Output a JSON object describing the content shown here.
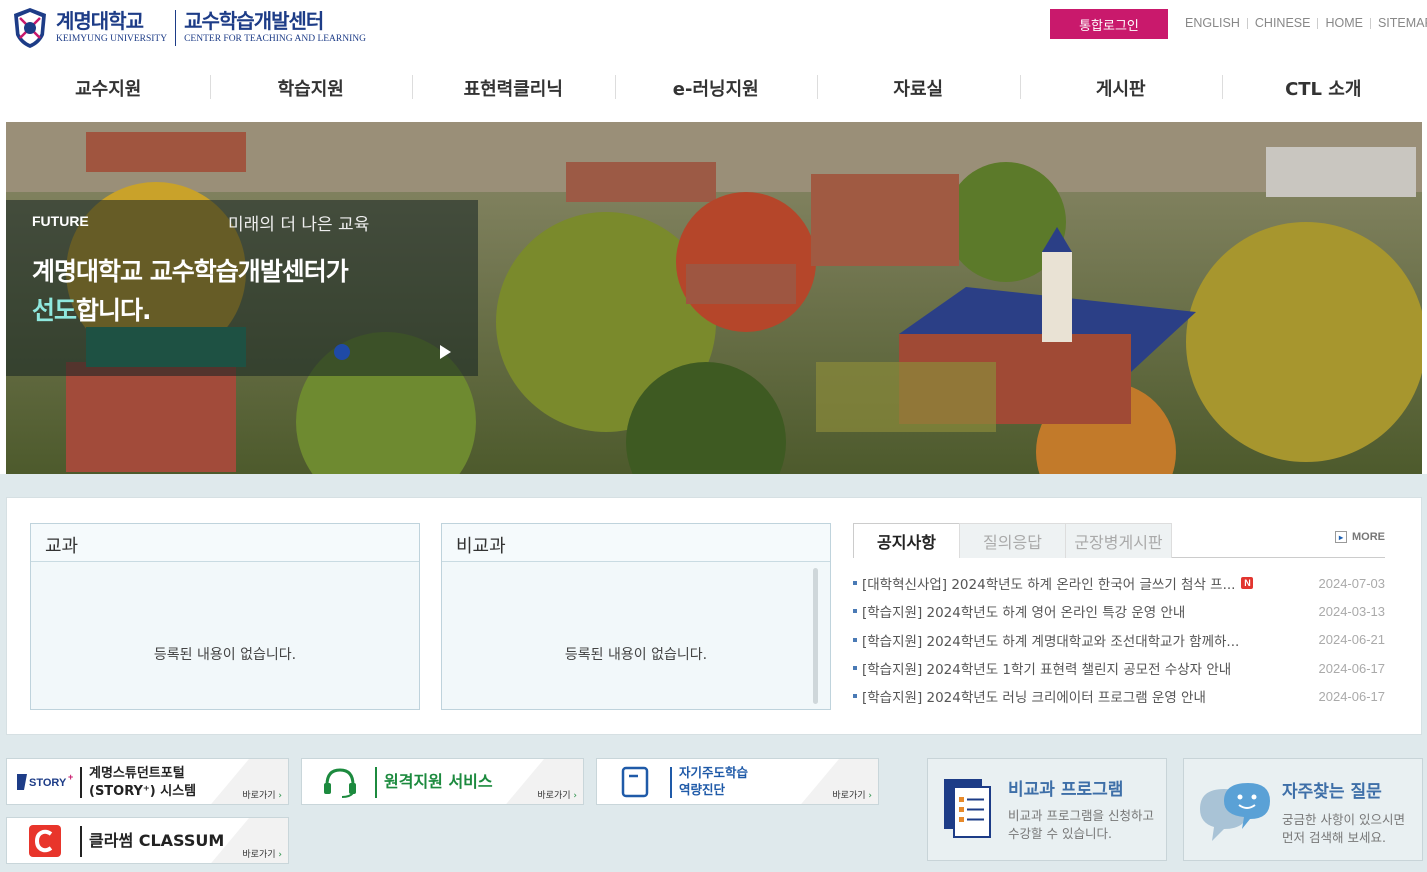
{
  "header": {
    "logo_ko": "계명대학교",
    "logo_en": "KEIMYUNG UNIVERSITY",
    "center_ko": "교수학습개발센터",
    "center_en": "CENTER FOR TEACHING AND LEARNING",
    "login_label": "통합로그인",
    "util_links": [
      "ENGLISH",
      "CHINESE",
      "HOME",
      "SITEMAP"
    ]
  },
  "nav": [
    "교수지원",
    "학습지원",
    "표현력클리닉",
    "e-러닝지원",
    "자료실",
    "게시판",
    "CTL 소개"
  ],
  "hero": {
    "tag": "FUTURE",
    "subtitle": "미래의 더 나은 교육",
    "line1": "계명대학교 교수학습개발센터가",
    "line2_highlight": "선도",
    "line2_rest": "합니다."
  },
  "boxes": {
    "curricular": {
      "title": "교과",
      "empty": "등록된 내용이 없습니다."
    },
    "extracurricular": {
      "title": "비교과",
      "empty": "등록된 내용이 없습니다."
    }
  },
  "notice": {
    "tabs": [
      "공지사항",
      "질의응답",
      "군장병게시판"
    ],
    "more": "MORE",
    "new_badge": "N",
    "items": [
      {
        "title": "[대학혁신사업] 2024학년도 하계 온라인 한국어 글쓰기 첨삭 프...",
        "date": "2024-07-03",
        "new": true
      },
      {
        "title": "[학습지원] 2024학년도 하계 영어 온라인 특강 운영 안내",
        "date": "2024-03-13",
        "new": false
      },
      {
        "title": "[학습지원] 2024학년도 하계 계명대학교와 조선대학교가 함께하...",
        "date": "2024-06-21",
        "new": false
      },
      {
        "title": "[학습지원] 2024학년도 1학기 표현력 챌린지 공모전 수상자 안내",
        "date": "2024-06-17",
        "new": false
      },
      {
        "title": "[학습지원] 2024학년도 러닝 크리에이터 프로그램 운영 안내",
        "date": "2024-06-17",
        "new": false
      }
    ]
  },
  "quicklinks": {
    "story": {
      "line1": "계명스튜던트포털",
      "line2": "(STORY⁺) 시스템",
      "go": "바로가기"
    },
    "remote": {
      "label": "원격지원 서비스",
      "go": "바로가기"
    },
    "selfdirected": {
      "line1": "자기주도학습",
      "line2": "역량진단",
      "go": "바로가기"
    },
    "classum": {
      "label": "클라썸 CLASSUM",
      "go": "바로가기"
    }
  },
  "cards": {
    "program": {
      "title": "비교과 프로그램",
      "desc1": "비교과 프로그램을 신청하고",
      "desc2": "수강할 수 있습니다."
    },
    "faq": {
      "title": "자주찾는 질문",
      "desc1": "궁금한 사항이 있으시면",
      "desc2": "먼저 검색해 보세요."
    }
  },
  "colors": {
    "brand": "#1d3c87",
    "login": "#c9196c",
    "accent_text": "#8fe8de"
  }
}
